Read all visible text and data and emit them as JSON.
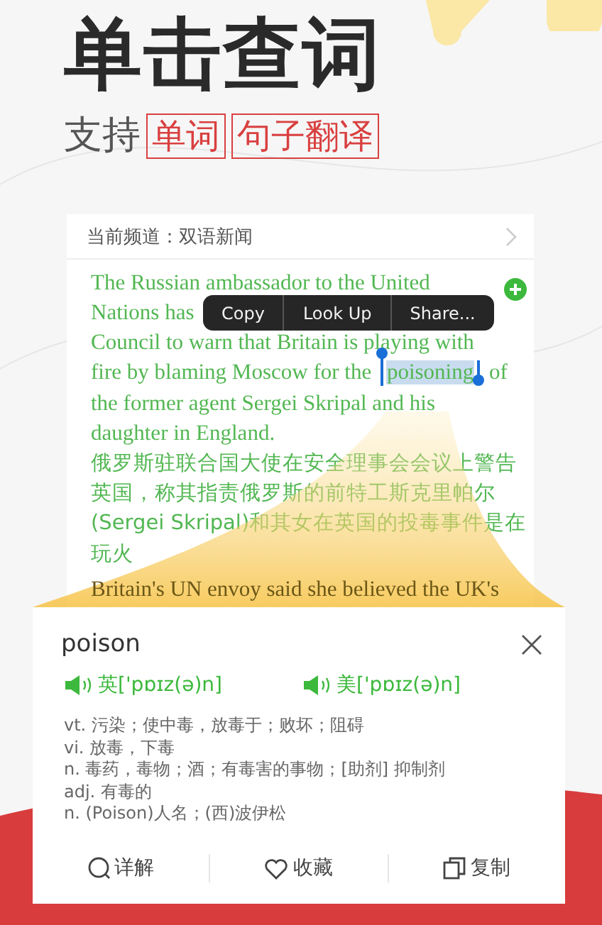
{
  "headline": "单击查词",
  "subtitle": {
    "text": "支持",
    "tags": [
      "单词",
      "句子翻译"
    ]
  },
  "article": {
    "channel": "当前频道：双语新闻",
    "en_lines": [
      [
        {
          "text": "The Russian ambassador to the United",
          "selected": false
        }
      ],
      [
        {
          "text": "Nations has",
          "selected": false
        }
      ],
      [
        {
          "text": "Council to warn that Britain is playing with",
          "selected": false
        }
      ],
      [
        {
          "text": "fire by blaming Moscow for the ",
          "selected": false
        },
        {
          "text": "poisoning",
          "selected": true
        },
        {
          "text": " of",
          "selected": false
        }
      ],
      [
        {
          "text": "the former agent Sergei Skripal and his",
          "selected": false
        }
      ],
      [
        {
          "text": "daughter in England.",
          "selected": false
        }
      ]
    ],
    "zh_lines": [
      "俄罗斯驻联合国大使在安全理事会会议上警告",
      "英国，称其指责俄罗斯的前特工斯克里帕尔",
      "(Sergei Skripal)和其女在英国的投毒事件是在",
      "玩火"
    ],
    "next_line": "Britain's UN envoy said she believed the UK's"
  },
  "context_menu": [
    "Copy",
    "Look Up",
    "Share..."
  ],
  "dictionary": {
    "word": "poison",
    "pronunciations": [
      "英['pɒɪz(ə)n]",
      "美['pɒɪz(ə)n]"
    ],
    "definitions": [
      "vt. 污染；使中毒，放毒于；败坏；阻碍",
      "vi. 放毒，下毒",
      "n. 毒药，毒物；酒；有毒害的事物；[助剂] 抑制剂",
      "adj. 有毒的",
      "n. (Poison)人名；(西)波伊松"
    ],
    "actions": [
      {
        "kind": "detail",
        "label": "详解"
      },
      {
        "kind": "favorite",
        "label": "收藏"
      },
      {
        "kind": "copy",
        "label": "复制"
      }
    ]
  }
}
